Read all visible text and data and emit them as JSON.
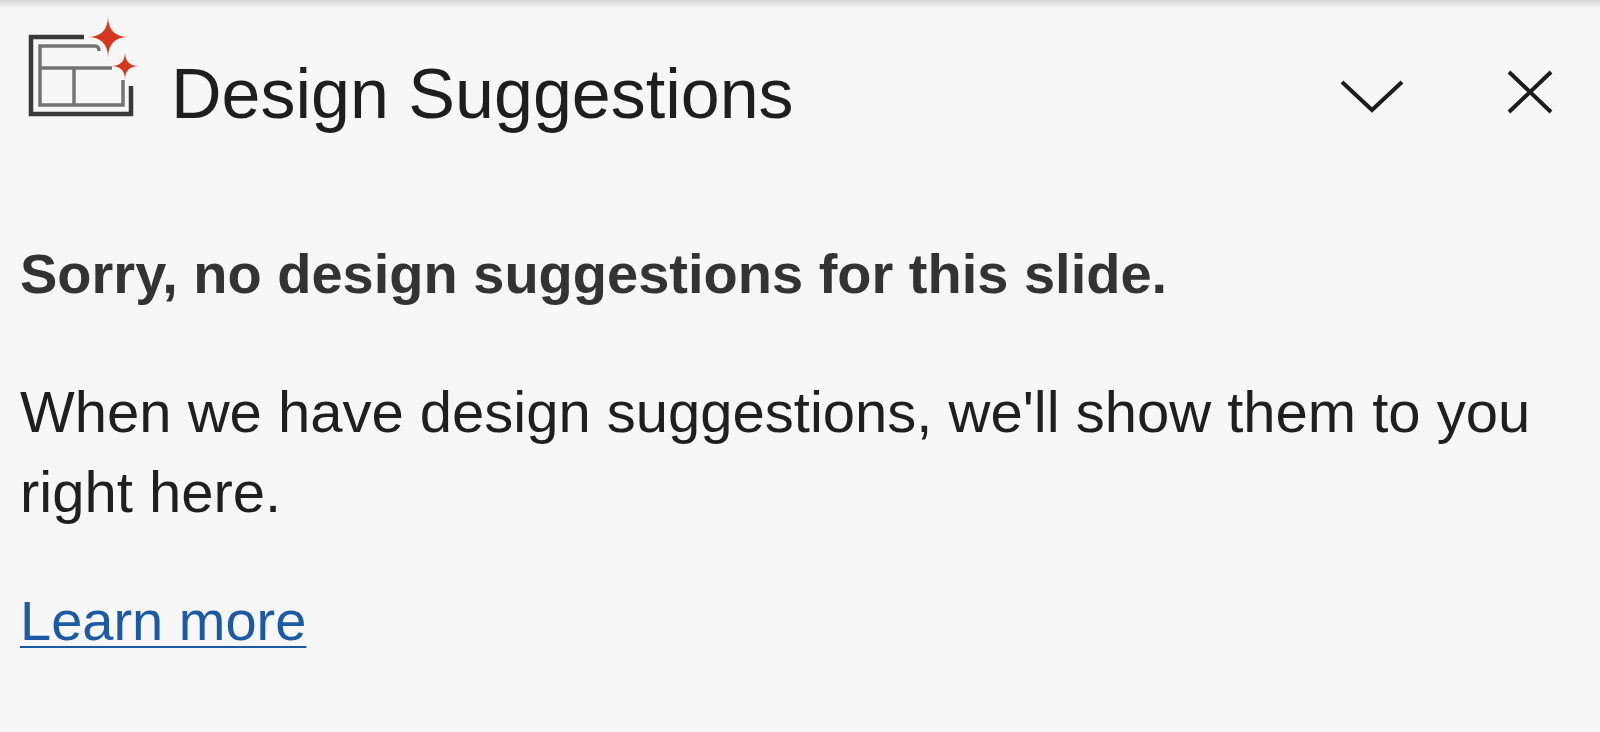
{
  "panel": {
    "title": "Design Suggestions"
  },
  "message": {
    "heading": "Sorry, no design suggestions for this slide.",
    "body": "When we have design suggestions, we'll show them to you right here."
  },
  "link": {
    "label": "Learn more"
  }
}
